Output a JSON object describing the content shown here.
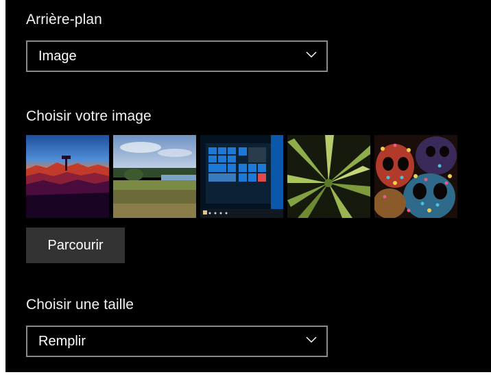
{
  "background": {
    "label": "Arrière-plan",
    "selected": "Image"
  },
  "picture": {
    "label": "Choisir votre image",
    "thumbnails": [
      {
        "name": "firewatch-sunset"
      },
      {
        "name": "lake-landscape"
      },
      {
        "name": "windows-start-screen"
      },
      {
        "name": "agave-plant"
      },
      {
        "name": "decorated-skulls"
      }
    ],
    "browse_label": "Parcourir"
  },
  "fit": {
    "label": "Choisir une taille",
    "selected": "Remplir"
  },
  "colors": {
    "panel_bg": "#000000",
    "button_bg": "#333333",
    "dropdown_border": "#8a8a8a"
  }
}
